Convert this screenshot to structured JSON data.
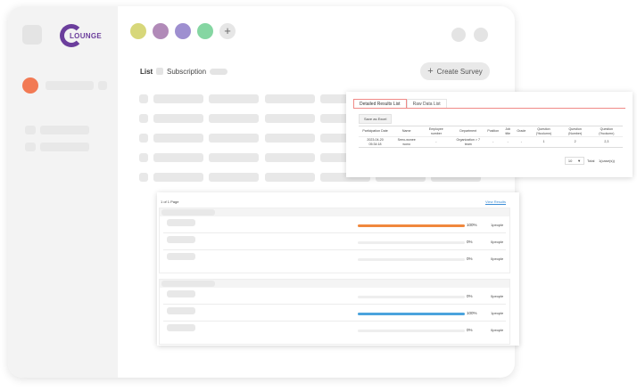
{
  "app": {
    "logo_text": "LOUNGE"
  },
  "toolbar": {
    "list_label": "List",
    "subscription_label": "Subscription",
    "create_survey_label": "Create Survey",
    "create_survey_icon": "plus-icon",
    "palette": [
      "#d7d77a",
      "#b18ab8",
      "#9e8fd0",
      "#85d6a2"
    ],
    "add_color_icon": "plus-icon"
  },
  "sidebar": {
    "active_dot_color": "#f27a54"
  },
  "results_panel": {
    "tabs": [
      {
        "label": "Detailed Results List",
        "active": true
      },
      {
        "label": "Raw Data List",
        "active": false
      }
    ],
    "save_button": "Save as Excel",
    "columns": [
      "Participation Date",
      "Name",
      "Employee number",
      "Department",
      "Position",
      "Job title",
      "Grade",
      "Question (%column)",
      "Question (Number)",
      "Question (%column)"
    ],
    "rows": [
      [
        "2023-04-20 05:34:18",
        "Seeo-wonee wono",
        "-",
        "Organization > 7 team",
        "-",
        "-",
        "-",
        "1",
        "2",
        "2,3"
      ]
    ],
    "page_size": "10",
    "total_text": "Total",
    "total_count": "1(case(s))"
  },
  "summary_panel": {
    "page_info": "1 of 1 Page",
    "view_results_link": "View Results",
    "groups": [
      {
        "rows": [
          {
            "progress": 1.0,
            "pct": "100%",
            "count": "1people",
            "color": "#f0883d"
          },
          {
            "progress": 0,
            "pct": "0%",
            "count": "0people",
            "color": "#f0883d"
          },
          {
            "progress": 0,
            "pct": "0%",
            "count": "0people",
            "color": "#f0883d"
          }
        ]
      },
      {
        "rows": [
          {
            "progress": 0,
            "pct": "0%",
            "count": "0people",
            "color": "#4aa3dd"
          },
          {
            "progress": 1.0,
            "pct": "100%",
            "count": "1people",
            "color": "#4aa3dd"
          },
          {
            "progress": 0,
            "pct": "0%",
            "count": "0people",
            "color": "#4aa3dd"
          }
        ]
      }
    ]
  }
}
